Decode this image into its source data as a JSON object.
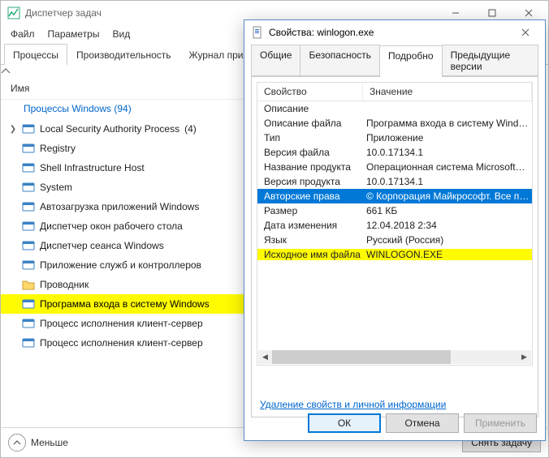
{
  "tm": {
    "title": "Диспетчер задач",
    "menu": {
      "file": "Файл",
      "options": "Параметры",
      "view": "Вид"
    },
    "tabs": {
      "processes": "Процессы",
      "performance": "Производительность",
      "app_history": "Журнал прило"
    },
    "column_name": "Имя",
    "group_title": "Процессы Windows (94)",
    "items": [
      {
        "label": "Local Security Authority Process",
        "count": "(4)",
        "expandable": true
      },
      {
        "label": "Registry",
        "count": "",
        "expandable": false
      },
      {
        "label": "Shell Infrastructure Host",
        "count": "",
        "expandable": false
      },
      {
        "label": "System",
        "count": "",
        "expandable": false
      },
      {
        "label": "Автозагрузка приложений Windows",
        "count": "",
        "expandable": false
      },
      {
        "label": "Диспетчер окон рабочего стола",
        "count": "",
        "expandable": false
      },
      {
        "label": "Диспетчер сеанса  Windows",
        "count": "",
        "expandable": false
      },
      {
        "label": "Приложение служб и контроллеров",
        "count": "",
        "expandable": false
      },
      {
        "label": "Проводник",
        "count": "",
        "expandable": false,
        "icon": "folder"
      },
      {
        "label": "Программа входа в систему Windows",
        "count": "",
        "expandable": false,
        "highlighted": true
      },
      {
        "label": "Процесс исполнения клиент-сервер",
        "count": "",
        "expandable": false
      },
      {
        "label": "Процесс исполнения клиент-сервер",
        "count": "",
        "expandable": false
      }
    ],
    "footer": {
      "fewer": "Меньше",
      "end_task": "Снять задачу"
    }
  },
  "props": {
    "title": "Свойства: winlogon.exe",
    "tabs": {
      "general": "Общие",
      "security": "Безопасность",
      "details": "Подробно",
      "previous": "Предыдущие версии"
    },
    "columns": {
      "property": "Свойство",
      "value": "Значение"
    },
    "section_description": "Описание",
    "rows": [
      {
        "k": "Описание файла",
        "v": "Программа входа в систему Windows"
      },
      {
        "k": "Тип",
        "v": "Приложение"
      },
      {
        "k": "Версия файла",
        "v": "10.0.17134.1"
      },
      {
        "k": "Название продукта",
        "v": "Операционная система Microsoft® W…"
      },
      {
        "k": "Версия продукта",
        "v": "10.0.17134.1"
      },
      {
        "k": "Авторские права",
        "v": "© Корпорация Майкрософт. Все пра…",
        "selected": true
      },
      {
        "k": "Размер",
        "v": "661 КБ"
      },
      {
        "k": "Дата изменения",
        "v": "12.04.2018 2:34"
      },
      {
        "k": "Язык",
        "v": "Русский (Россия)"
      },
      {
        "k": "Исходное имя файла",
        "v": "WINLOGON.EXE",
        "highlighted": true
      }
    ],
    "remove_link": "Удаление свойств и личной информации",
    "buttons": {
      "ok": "ОК",
      "cancel": "Отмена",
      "apply": "Применить"
    }
  }
}
